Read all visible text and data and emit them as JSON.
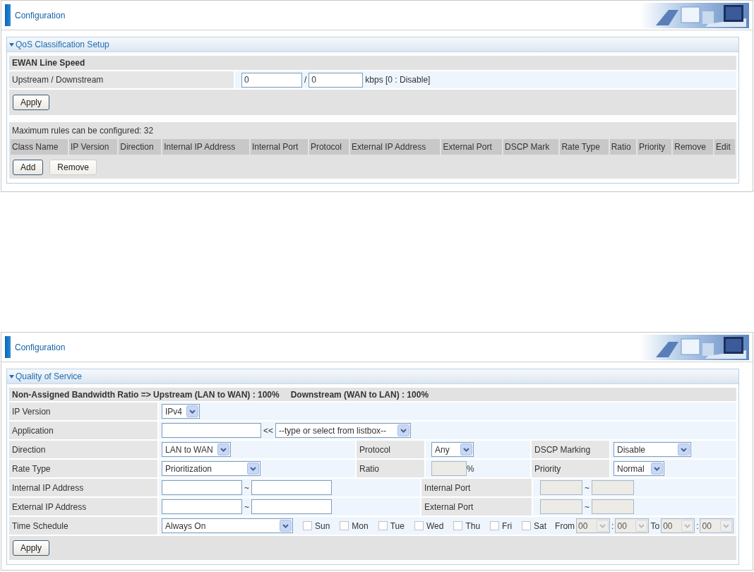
{
  "classification_page": {
    "header": {
      "title": "Configuration"
    },
    "section": {
      "title": "QoS Classification Setup",
      "expanded": true
    },
    "line_speed": {
      "heading": "EWAN Line Speed",
      "label": "Upstream / Downstream",
      "upstream": "0",
      "separator": "/",
      "downstream": "0",
      "unit": "kbps [0 : Disable]",
      "apply_button": "Apply"
    },
    "rules": {
      "max_note": "Maximum rules can be configured: 32",
      "columns": [
        "Class Name",
        "IP Version",
        "Direction",
        "Internal IP Address",
        "Internal Port",
        "Protocol",
        "External IP Address",
        "External Port",
        "DSCP Mark",
        "Rate Type",
        "Ratio",
        "Priority",
        "Remove",
        "Edit"
      ],
      "buttons": [
        "Add",
        "Remove"
      ]
    }
  },
  "qos_page": {
    "header": {
      "title": "Configuration"
    },
    "section": {
      "title": "Quality of Service",
      "expanded": true
    },
    "bandwidth_note": {
      "upstream": "Non-Assigned Bandwidth Ratio => Upstream (LAN to WAN) : 100%",
      "downstream": "Downstream (WAN to LAN) : 100%"
    },
    "ip_version": {
      "label": "IP Version",
      "value": "IPv4"
    },
    "application": {
      "label": "Application",
      "separator": "<<",
      "listbox": "--type or select from listbox--"
    },
    "direction": {
      "label": "Direction",
      "value": "LAN to WAN"
    },
    "protocol": {
      "label": "Protocol",
      "value": "Any"
    },
    "dscp_marking": {
      "label": "DSCP Marking",
      "value": "Disable"
    },
    "rate_type": {
      "label": "Rate Type",
      "value": "Prioritization"
    },
    "ratio": {
      "label": "Ratio",
      "unit": "%",
      "disabled": true
    },
    "priority": {
      "label": "Priority",
      "value": "Normal"
    },
    "internal_ip": {
      "label": "Internal IP Address",
      "separator": "~"
    },
    "internal_port": {
      "label": "Internal Port",
      "separator": "~",
      "disabled": true
    },
    "external_ip": {
      "label": "External IP Address",
      "separator": "~"
    },
    "external_port": {
      "label": "External Port",
      "separator": "~",
      "disabled": true
    },
    "time_schedule": {
      "label": "Time Schedule",
      "value": "Always On",
      "days": [
        {
          "label": "Sun",
          "checked": false
        },
        {
          "label": "Mon",
          "checked": false
        },
        {
          "label": "Tue",
          "checked": false
        },
        {
          "label": "Wed",
          "checked": false
        },
        {
          "label": "Thu",
          "checked": false
        },
        {
          "label": "Fri",
          "checked": false
        },
        {
          "label": "Sat",
          "checked": false
        }
      ],
      "time_range": {
        "disabled": true,
        "from_label": "From",
        "from_hour": "00",
        "from_minute": "00",
        "separator": ":",
        "to_label": "To",
        "to_hour": "00",
        "to_minute": "00"
      }
    },
    "apply_button": "Apply"
  }
}
